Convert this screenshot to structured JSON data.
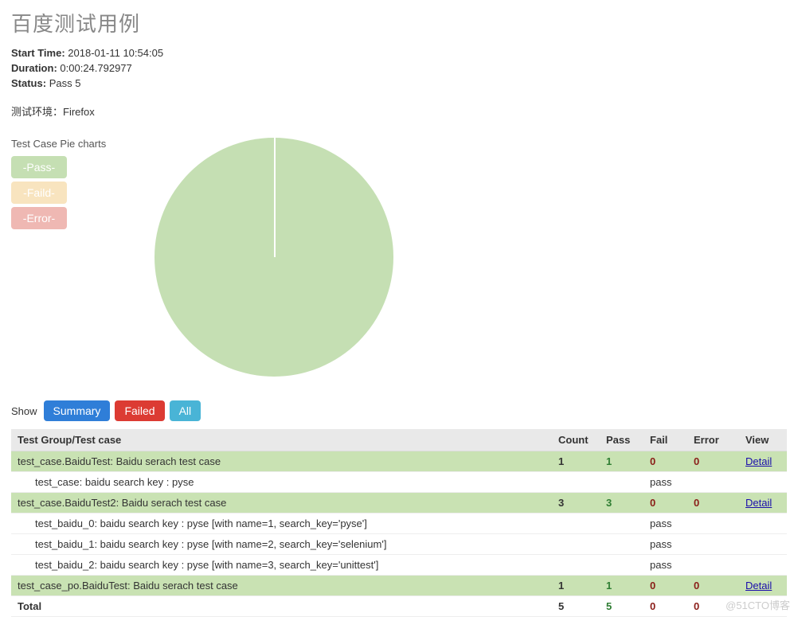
{
  "title": "百度测试用例",
  "meta": {
    "start_label": "Start Time:",
    "start_value": "2018-01-11 10:54:05",
    "duration_label": "Duration:",
    "duration_value": "0:00:24.792977",
    "status_label": "Status:",
    "status_value": "Pass 5"
  },
  "env_label": "测试环境：",
  "env_value": "Firefox",
  "chart_title": "Test Case Pie charts",
  "legend": {
    "pass": "-Pass-",
    "faild": "-Faild-",
    "error": "-Error-"
  },
  "chart_data": {
    "type": "pie",
    "title": "Test Case Pie charts",
    "categories": [
      "Pass",
      "Faild",
      "Error"
    ],
    "values": [
      5,
      0,
      0
    ],
    "colors": [
      "#c5dfb3",
      "#f8e4bf",
      "#efb8b3"
    ]
  },
  "show_label": "Show",
  "buttons": {
    "summary": "Summary",
    "failed": "Failed",
    "all": "All"
  },
  "table": {
    "headers": {
      "name": "Test Group/Test case",
      "count": "Count",
      "pass": "Pass",
      "fail": "Fail",
      "error": "Error",
      "view": "View"
    },
    "detail_label": "Detail",
    "pass_txt": "pass",
    "groups": [
      {
        "name": "test_case.BaiduTest: Baidu serach test case",
        "count": "1",
        "pass": "1",
        "fail": "0",
        "error": "0",
        "cases": [
          {
            "name": "test_case: baidu search key : pyse"
          }
        ]
      },
      {
        "name": "test_case.BaiduTest2: Baidu serach test case",
        "count": "3",
        "pass": "3",
        "fail": "0",
        "error": "0",
        "cases": [
          {
            "name": "test_baidu_0: baidu search key : pyse [with name=1, search_key='pyse']"
          },
          {
            "name": "test_baidu_1: baidu search key : pyse [with name=2, search_key='selenium']"
          },
          {
            "name": "test_baidu_2: baidu search key : pyse [with name=3, search_key='unittest']"
          }
        ]
      },
      {
        "name": "test_case_po.BaiduTest: Baidu serach test case",
        "count": "1",
        "pass": "1",
        "fail": "0",
        "error": "0",
        "cases": []
      }
    ],
    "total": {
      "label": "Total",
      "count": "5",
      "pass": "5",
      "fail": "0",
      "error": "0"
    }
  },
  "watermark": "@51CTO博客"
}
